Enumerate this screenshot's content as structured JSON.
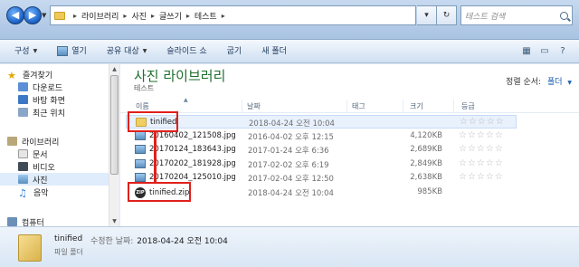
{
  "address": {
    "segments": [
      "라이브러리",
      "사진",
      "글쓰기",
      "테스트"
    ],
    "search_placeholder": "테스트 검색"
  },
  "toolbar": {
    "items": [
      {
        "label": "구성",
        "dropdown": true
      },
      {
        "label": "열기",
        "dropdown": false
      },
      {
        "label": "공유 대상",
        "dropdown": true
      },
      {
        "label": "슬라이드 쇼",
        "dropdown": false
      },
      {
        "label": "굽기",
        "dropdown": false
      },
      {
        "label": "새 폴더",
        "dropdown": false
      }
    ]
  },
  "nav": {
    "favorites_label": "즐겨찾기",
    "favorites": [
      "다운로드",
      "바탕 화면",
      "최근 위치"
    ],
    "libraries_label": "라이브러리",
    "libraries": [
      "문서",
      "비디오",
      "사진",
      "음악"
    ],
    "computer_label": "컴퓨터"
  },
  "library": {
    "title": "사진 라이브러리",
    "subtitle": "테스트",
    "arrange_label": "정렬 순서:",
    "arrange_value": "폴더"
  },
  "columns": {
    "name": "이름",
    "date": "날짜",
    "tags": "태그",
    "size": "크기",
    "rating": "등급"
  },
  "files": [
    {
      "name": "tinified",
      "date": "2018-04-24 오전 10:04",
      "size": "",
      "type": "folder"
    },
    {
      "name": "20160402_121508.jpg",
      "date": "2016-04-02 오후 12:15",
      "size": "4,120KB",
      "type": "image"
    },
    {
      "name": "20170124_183643.jpg",
      "date": "2017-01-24 오후 6:36",
      "size": "2,689KB",
      "type": "image"
    },
    {
      "name": "20170202_181928.jpg",
      "date": "2017-02-02 오후 6:19",
      "size": "2,849KB",
      "type": "image"
    },
    {
      "name": "20170204_125010.jpg",
      "date": "2017-02-04 오후 12:50",
      "size": "2,638KB",
      "type": "image"
    },
    {
      "name": "tinified.zip",
      "date": "2018-04-24 오전 10:04",
      "size": "985KB",
      "type": "zip"
    }
  ],
  "details": {
    "name": "tinified",
    "modified_label": "수정한 날짜:",
    "modified_value": "2018-04-24 오전 10:04",
    "type": "파일 폴더"
  },
  "annotation_color": "#e0201c"
}
